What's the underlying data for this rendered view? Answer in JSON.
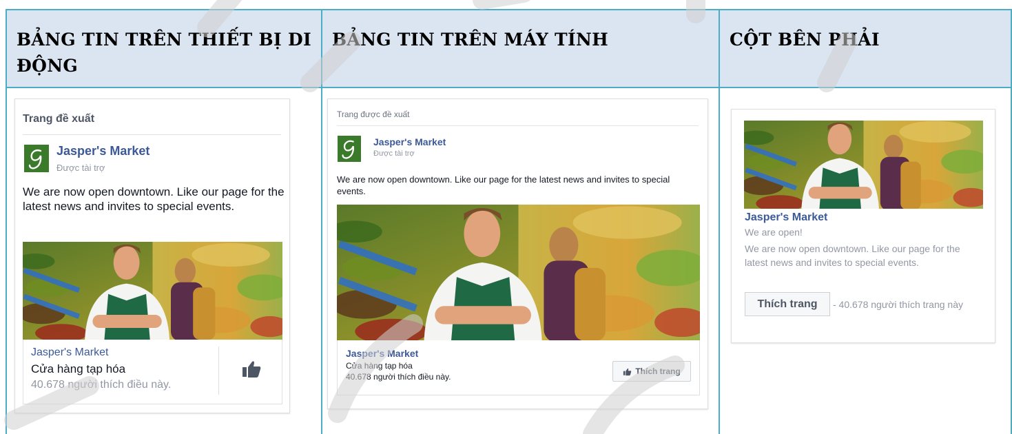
{
  "columns": {
    "mobile": {
      "header": "BẢNG TIN TRÊN THIẾT BỊ DI ĐỘNG"
    },
    "desktop": {
      "header": "BẢNG TIN TRÊN MÁY TÍNH"
    },
    "right": {
      "header": "CỘT BÊN PHẢI"
    }
  },
  "mobile_card": {
    "title": "Trang đề xuất",
    "page_name": "Jasper's Market",
    "sponsored": "Được tài trợ",
    "text": "We are now open downtown. Like our page for the latest news and invites to special events.",
    "footer_name": "Jasper's Market",
    "footer_category": "Cửa hàng tạp hóa",
    "footer_count": "40.678 người thích điều này.",
    "like_icon": "thumbs-up-icon"
  },
  "desktop_card": {
    "title": "Trang được đề xuất",
    "page_name": "Jasper's Market",
    "sponsored": "Được tài trợ",
    "text": "We are now open downtown. Like our page for the latest news and invites to special events.",
    "footer_name": "Jasper's Market",
    "footer_category": "Cửa hàng tạp hóa",
    "footer_count": "40.678 người thích điều này.",
    "like_button": "Thích trang"
  },
  "right_card": {
    "page_name": "Jasper's Market",
    "subtitle": "We are open!",
    "text": "We are now open downtown. Like our page for the latest news and invites to special events.",
    "like_button": "Thích trang",
    "like_count": "- 40.678 người thích trang này"
  },
  "colors": {
    "header_bg": "#dbe5f1",
    "border": "#4bacc6",
    "fb_link": "#3b5998",
    "logo_green": "#3b7a2a"
  }
}
